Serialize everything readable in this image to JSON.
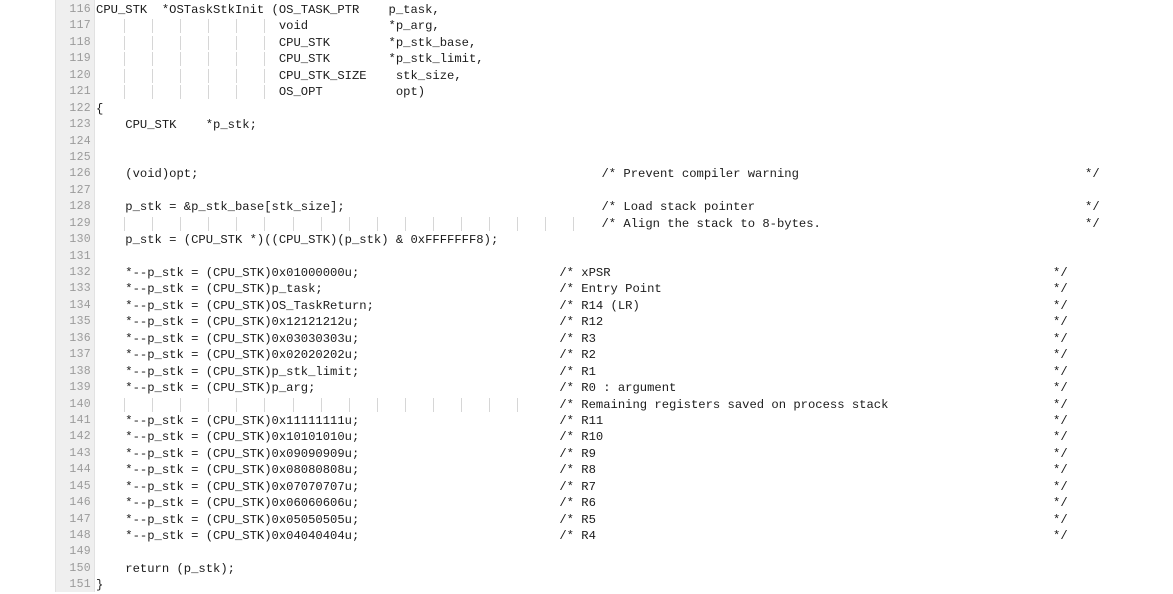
{
  "editor": {
    "language": "c",
    "first_line_number": 116,
    "colors": {
      "background": "#ffffff",
      "gutter_background": "#efefef",
      "gutter_text": "#9b9b9b",
      "code_text": "#1b1b1b",
      "indent_guide": "#d6d6d6"
    }
  },
  "lines": [
    {
      "number": 116,
      "code": "CPU_STK  *OSTaskStkInit (OS_TASK_PTR    p_task,",
      "indent": 0,
      "comment": "",
      "comment_col": 0,
      "comment_end": "",
      "guides": []
    },
    {
      "number": 117,
      "code": "                         void           *p_arg,",
      "indent": 0,
      "comment": "",
      "comment_col": 0,
      "comment_end": "",
      "guides": [
        4,
        8,
        12,
        16,
        20,
        24
      ]
    },
    {
      "number": 118,
      "code": "                         CPU_STK        *p_stk_base,",
      "indent": 0,
      "comment": "",
      "comment_col": 0,
      "comment_end": "",
      "guides": [
        4,
        8,
        12,
        16,
        20,
        24
      ]
    },
    {
      "number": 119,
      "code": "                         CPU_STK        *p_stk_limit,",
      "indent": 0,
      "comment": "",
      "comment_col": 0,
      "comment_end": "",
      "guides": [
        4,
        8,
        12,
        16,
        20,
        24
      ]
    },
    {
      "number": 120,
      "code": "                         CPU_STK_SIZE    stk_size,",
      "indent": 0,
      "comment": "",
      "comment_col": 0,
      "comment_end": "",
      "guides": [
        4,
        8,
        12,
        16,
        20,
        24
      ]
    },
    {
      "number": 121,
      "code": "                         OS_OPT          opt)",
      "indent": 0,
      "comment": "",
      "comment_col": 0,
      "comment_end": "",
      "guides": [
        4,
        8,
        12,
        16,
        20,
        24
      ]
    },
    {
      "number": 122,
      "code": "{",
      "indent": 0,
      "comment": "",
      "comment_col": 0,
      "comment_end": "",
      "guides": []
    },
    {
      "number": 123,
      "code": "    CPU_STK    *p_stk;",
      "indent": 4,
      "comment": "",
      "comment_col": 0,
      "comment_end": "",
      "guides": []
    },
    {
      "number": 124,
      "code": "",
      "indent": 0,
      "comment": "",
      "comment_col": 0,
      "comment_end": "",
      "guides": []
    },
    {
      "number": 125,
      "code": "",
      "indent": 0,
      "comment": "",
      "comment_col": 0,
      "comment_end": "",
      "guides": []
    },
    {
      "number": 126,
      "code": "    (void)opt;",
      "indent": 4,
      "comment": "/* Prevent compiler warning",
      "comment_col": 72,
      "comment_end": "*/",
      "guides": []
    },
    {
      "number": 127,
      "code": "",
      "indent": 0,
      "comment": "",
      "comment_col": 0,
      "comment_end": "",
      "guides": []
    },
    {
      "number": 128,
      "code": "    p_stk = &p_stk_base[stk_size];",
      "indent": 4,
      "comment": "/* Load stack pointer",
      "comment_col": 72,
      "comment_end": "*/",
      "guides": []
    },
    {
      "number": 129,
      "code": "",
      "indent": 0,
      "comment": "/* Align the stack to 8-bytes.",
      "comment_col": 72,
      "comment_end": "*/",
      "guides": [
        4,
        8,
        12,
        16,
        20,
        24,
        28,
        32,
        36,
        40,
        44,
        48,
        52,
        56,
        60,
        64,
        68
      ]
    },
    {
      "number": 130,
      "code": "    p_stk = (CPU_STK *)((CPU_STK)(p_stk) & 0xFFFFFFF8);",
      "indent": 4,
      "comment": "",
      "comment_col": 0,
      "comment_end": "",
      "guides": []
    },
    {
      "number": 131,
      "code": "",
      "indent": 0,
      "comment": "",
      "comment_col": 0,
      "comment_end": "",
      "guides": []
    },
    {
      "number": 132,
      "code": "    *--p_stk = (CPU_STK)0x01000000u;",
      "indent": 4,
      "comment": "/* xPSR",
      "comment_col": 66,
      "comment_end": "*/",
      "guides": []
    },
    {
      "number": 133,
      "code": "    *--p_stk = (CPU_STK)p_task;",
      "indent": 4,
      "comment": "/* Entry Point",
      "comment_col": 66,
      "comment_end": "*/",
      "guides": []
    },
    {
      "number": 134,
      "code": "    *--p_stk = (CPU_STK)OS_TaskReturn;",
      "indent": 4,
      "comment": "/* R14 (LR)",
      "comment_col": 66,
      "comment_end": "*/",
      "guides": []
    },
    {
      "number": 135,
      "code": "    *--p_stk = (CPU_STK)0x12121212u;",
      "indent": 4,
      "comment": "/* R12",
      "comment_col": 66,
      "comment_end": "*/",
      "guides": []
    },
    {
      "number": 136,
      "code": "    *--p_stk = (CPU_STK)0x03030303u;",
      "indent": 4,
      "comment": "/* R3",
      "comment_col": 66,
      "comment_end": "*/",
      "guides": []
    },
    {
      "number": 137,
      "code": "    *--p_stk = (CPU_STK)0x02020202u;",
      "indent": 4,
      "comment": "/* R2",
      "comment_col": 66,
      "comment_end": "*/",
      "guides": []
    },
    {
      "number": 138,
      "code": "    *--p_stk = (CPU_STK)p_stk_limit;",
      "indent": 4,
      "comment": "/* R1",
      "comment_col": 66,
      "comment_end": "*/",
      "guides": []
    },
    {
      "number": 139,
      "code": "    *--p_stk = (CPU_STK)p_arg;",
      "indent": 4,
      "comment": "/* R0 : argument",
      "comment_col": 66,
      "comment_end": "*/",
      "guides": []
    },
    {
      "number": 140,
      "code": "",
      "indent": 0,
      "comment": "/* Remaining registers saved on process stack",
      "comment_col": 66,
      "comment_end": "*/",
      "guides": [
        4,
        8,
        12,
        16,
        20,
        24,
        28,
        32,
        36,
        40,
        44,
        48,
        52,
        56,
        60
      ]
    },
    {
      "number": 141,
      "code": "    *--p_stk = (CPU_STK)0x11111111u;",
      "indent": 4,
      "comment": "/* R11",
      "comment_col": 66,
      "comment_end": "*/",
      "guides": []
    },
    {
      "number": 142,
      "code": "    *--p_stk = (CPU_STK)0x10101010u;",
      "indent": 4,
      "comment": "/* R10",
      "comment_col": 66,
      "comment_end": "*/",
      "guides": []
    },
    {
      "number": 143,
      "code": "    *--p_stk = (CPU_STK)0x09090909u;",
      "indent": 4,
      "comment": "/* R9",
      "comment_col": 66,
      "comment_end": "*/",
      "guides": []
    },
    {
      "number": 144,
      "code": "    *--p_stk = (CPU_STK)0x08080808u;",
      "indent": 4,
      "comment": "/* R8",
      "comment_col": 66,
      "comment_end": "*/",
      "guides": []
    },
    {
      "number": 145,
      "code": "    *--p_stk = (CPU_STK)0x07070707u;",
      "indent": 4,
      "comment": "/* R7",
      "comment_col": 66,
      "comment_end": "*/",
      "guides": []
    },
    {
      "number": 146,
      "code": "    *--p_stk = (CPU_STK)0x06060606u;",
      "indent": 4,
      "comment": "/* R6",
      "comment_col": 66,
      "comment_end": "*/",
      "guides": []
    },
    {
      "number": 147,
      "code": "    *--p_stk = (CPU_STK)0x05050505u;",
      "indent": 4,
      "comment": "/* R5",
      "comment_col": 66,
      "comment_end": "*/",
      "guides": []
    },
    {
      "number": 148,
      "code": "    *--p_stk = (CPU_STK)0x04040404u;",
      "indent": 4,
      "comment": "/* R4",
      "comment_col": 66,
      "comment_end": "*/",
      "guides": []
    },
    {
      "number": 149,
      "code": "",
      "indent": 0,
      "comment": "",
      "comment_col": 0,
      "comment_end": "",
      "guides": []
    },
    {
      "number": 150,
      "code": "    return (p_stk);",
      "indent": 4,
      "comment": "",
      "comment_col": 0,
      "comment_end": "",
      "guides": []
    },
    {
      "number": 151,
      "code": "}",
      "indent": 0,
      "comment": "",
      "comment_col": 0,
      "comment_end": "",
      "guides": []
    }
  ]
}
